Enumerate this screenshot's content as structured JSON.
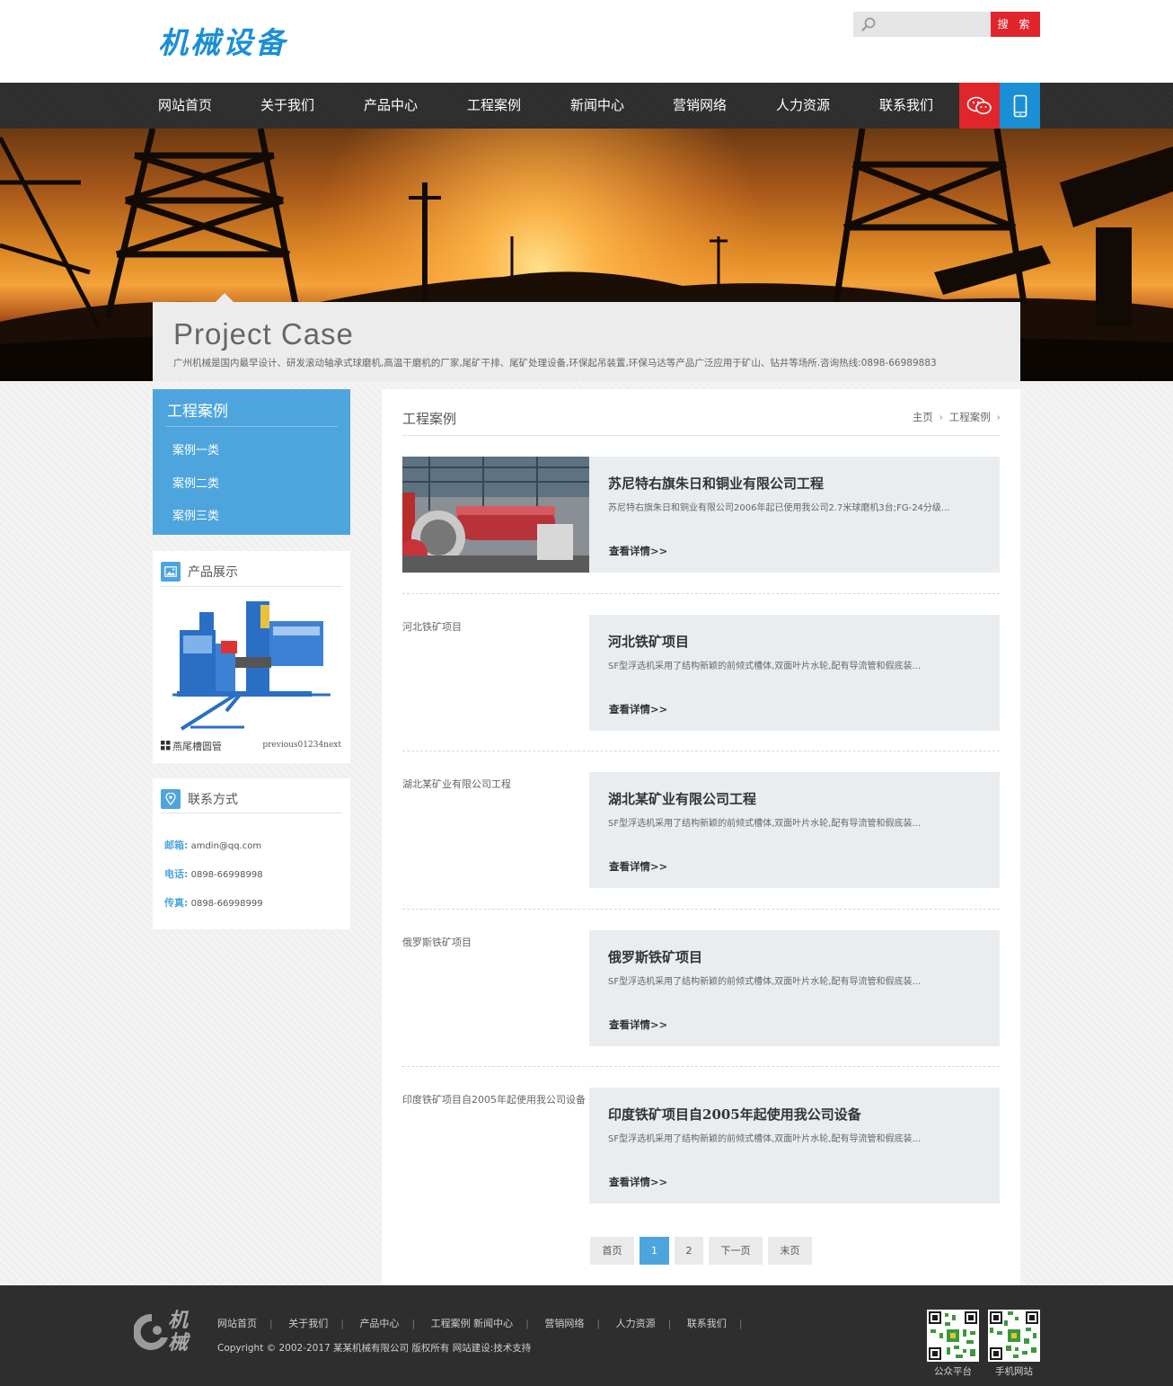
{
  "header": {
    "logo": "机械设备",
    "search": {
      "placeholder": "",
      "button": "搜 索"
    }
  },
  "nav": {
    "items": [
      "网站首页",
      "关于我们",
      "产品中心",
      "工程案例",
      "新闻中心",
      "营销网络",
      "人力资源",
      "联系我们"
    ]
  },
  "banner": {
    "title": "Project  Case",
    "description": "广州机械是国内最早设计、研发滚动轴承式球磨机,高温干磨机的厂家,尾矿干排、尾矿处理设备,环保起吊装置,环保马达等产品广泛应用于矿山、钻井等场所.咨询热线:0898-66989883"
  },
  "sidebar": {
    "category_title": "工程案例",
    "categories": [
      "案例一类",
      "案例二类",
      "案例三类"
    ],
    "product_title": "产品展示",
    "product_name": "燕尾槽圆管",
    "product_nav": "previous01234next",
    "contact_title": "联系方式",
    "contact": [
      {
        "label": "邮箱:",
        "value": "amdin@qq.com"
      },
      {
        "label": "电话:",
        "value": "0898-66998998"
      },
      {
        "label": "传真:",
        "value": "0898-66998999"
      }
    ]
  },
  "main": {
    "title": "工程案例",
    "breadcrumb": {
      "home": "主页",
      "current": "工程案例"
    },
    "more_label": "查看详情>>",
    "cases": [
      {
        "alt": "",
        "title": "苏尼特右旗朱日和铜业有限公司工程",
        "desc": "苏尼特右旗朱日和铜业有限公司2006年起已使用我公司2.7米球磨机3台;FG-24分级..."
      },
      {
        "alt": "河北铁矿项目",
        "title": "河北铁矿项目",
        "desc": "SF型浮选机采用了结构新颖的前倾式槽体,双面叶片水轮,配有导流管和假底装..."
      },
      {
        "alt": "湖北某矿业有限公司工程",
        "title": "湖北某矿业有限公司工程",
        "desc": "SF型浮选机采用了结构新颖的前倾式槽体,双面叶片水轮,配有导流管和假底装..."
      },
      {
        "alt": "俄罗斯铁矿项目",
        "title": "俄罗斯铁矿项目",
        "desc": "SF型浮选机采用了结构新颖的前倾式槽体,双面叶片水轮,配有导流管和假底装..."
      },
      {
        "alt": "印度铁矿项目自2005年起使用我公司设备",
        "title": "印度铁矿项目自2005年起使用我公司设备",
        "desc": "SF型浮选机采用了结构新颖的前倾式槽体,双面叶片水轮,配有导流管和假底装..."
      }
    ],
    "pager": [
      "首页",
      "1",
      "2",
      "下一页",
      "末页"
    ],
    "pager_current": "1"
  },
  "footer": {
    "logo_text": "机械",
    "links": [
      "网站首页",
      "关于我们",
      "产品中心",
      "工程案例 新闻中心",
      "营销网络",
      "人力资源",
      "联系我们"
    ],
    "copyright": "Copyright © 2002-2017 某某机械有限公司 版权所有 网站建设:技术支持",
    "qr_labels": [
      "公众平台",
      "手机网站"
    ]
  },
  "colors": {
    "accent": "#4ea5de",
    "brand": "#1b8fd6",
    "red": "#e1252d",
    "nav_bg": "#2d2d2d",
    "footer_bg": "#2e2e2e"
  }
}
